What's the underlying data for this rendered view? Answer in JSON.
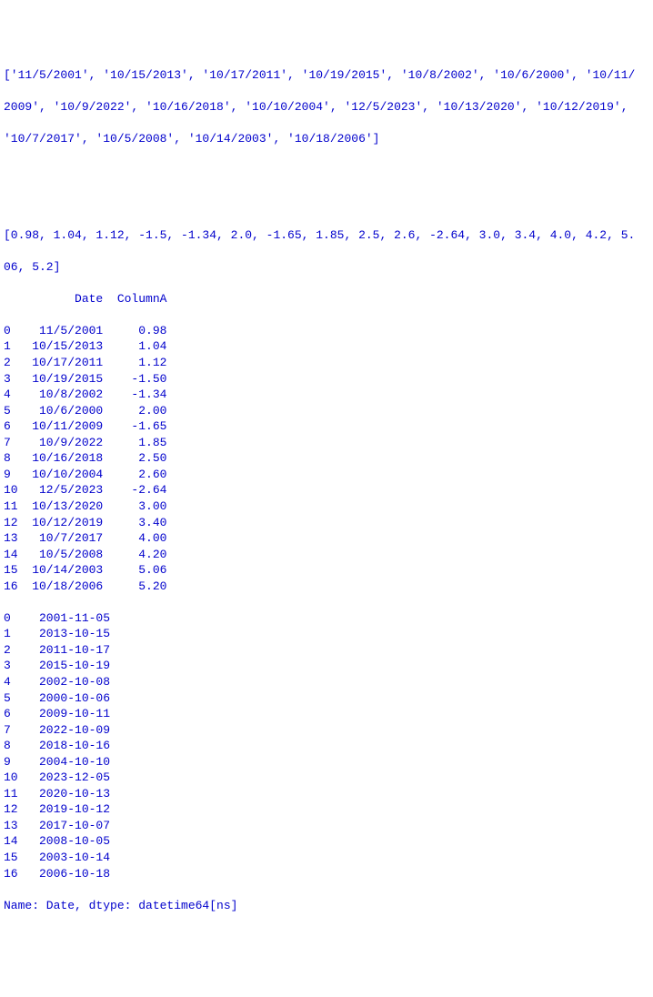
{
  "list1_line1": "['11/5/2001', '10/15/2013', '10/17/2011', '10/19/2015', '10/8/2002', '10/6/2000', '10/11/",
  "list1_line2": "2009', '10/9/2022', '10/16/2018', '10/10/2004', '12/5/2023', '10/13/2020', '10/12/2019',",
  "list1_line3": "'10/7/2017', '10/5/2008', '10/14/2003', '10/18/2006']",
  "list2_line1": "[0.98, 1.04, 1.12, -1.5, -1.34, 2.0, -1.65, 1.85, 2.5, 2.6, -2.64, 3.0, 3.4, 4.0, 4.2, 5.",
  "list2_line2": "06, 5.2]",
  "df_header": "          Date  ColumnA",
  "df_rows": [
    "0    11/5/2001     0.98",
    "1   10/15/2013     1.04",
    "2   10/17/2011     1.12",
    "3   10/19/2015    -1.50",
    "4    10/8/2002    -1.34",
    "5    10/6/2000     2.00",
    "6   10/11/2009    -1.65",
    "7    10/9/2022     1.85",
    "8   10/16/2018     2.50",
    "9   10/10/2004     2.60",
    "10   12/5/2023    -2.64",
    "11  10/13/2020     3.00",
    "12  10/12/2019     3.40",
    "13   10/7/2017     4.00",
    "14   10/5/2008     4.20",
    "15  10/14/2003     5.06",
    "16  10/18/2006     5.20"
  ],
  "series_rows": [
    "0    2001-11-05",
    "1    2013-10-15",
    "2    2011-10-17",
    "3    2015-10-19",
    "4    2002-10-08",
    "5    2000-10-06",
    "6    2009-10-11",
    "7    2022-10-09",
    "8    2018-10-16",
    "9    2004-10-10",
    "10   2023-12-05",
    "11   2020-10-13",
    "12   2019-10-12",
    "13   2017-10-07",
    "14   2008-10-05",
    "15   2003-10-14",
    "16   2006-10-18"
  ],
  "series_footer": "Name: Date, dtype: datetime64[ns]"
}
